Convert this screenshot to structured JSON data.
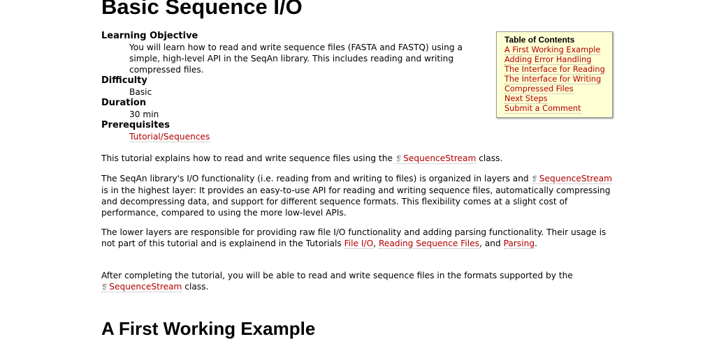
{
  "title": "Basic Sequence I/O",
  "meta": {
    "objective_label": "Learning Objective",
    "objective": "You will learn how to read and write sequence files (FASTA and FASTQ) using a simple, high-level API in the SeqAn library. This includes reading and writing compressed files.",
    "difficulty_label": "Difficulty",
    "difficulty": "Basic",
    "duration_label": "Duration",
    "duration": "30 min",
    "prereq_label": "Prerequisites",
    "prereq": "Tutorial/Sequences"
  },
  "toc": {
    "title": "Table of Contents",
    "items": [
      "A First Working Example",
      "Adding Error Handling",
      "The Interface for Reading",
      "The Interface for Writing",
      "Compressed Files",
      "Next Steps",
      "Submit a Comment"
    ]
  },
  "p1": {
    "a": "This tutorial explains how to read and write sequence files using the ",
    "link": "SequenceStream",
    "b": " class."
  },
  "p2": {
    "a": "The SeqAn library's I/O functionality (i.e. reading from and writing to files) is organized in layers and ",
    "link": "SequenceStream",
    "b": " is in the highest layer: It provides an easy-to-use API for reading and writing sequence files, automatically compressing and decompressing data, and support for different sequence formats. This flexibility comes at a slight cost of performance, compared to using the more low-level APIs."
  },
  "p3": {
    "a": "The lower layers are responsible for providing raw file I/O functionality and adding parsing functionality. Their usage is not part of this tutorial and is explainend in the Tutorials ",
    "l1": "File I/O",
    "s1": ", ",
    "l2": "Reading Sequence Files",
    "s2": ", and ",
    "l3": "Parsing",
    "b": "."
  },
  "p4": {
    "a": "After completing the tutorial, you will be able to read and write sequence files in the formats supported by the ",
    "link": "SequenceStream",
    "b": " class."
  },
  "section_title": "A First Working Example",
  "book_icon": "❡"
}
